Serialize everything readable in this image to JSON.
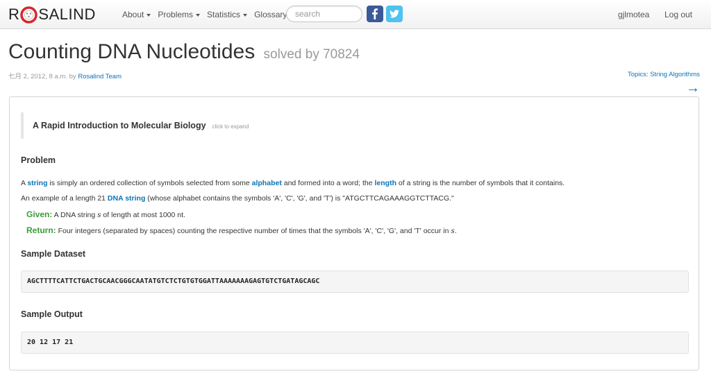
{
  "brand": {
    "name_left": "R",
    "name_right": "SALIND"
  },
  "nav": {
    "about": "About",
    "problems": "Problems",
    "statistics": "Statistics",
    "glossary": "Glossary",
    "search_placeholder": "search",
    "user": "gjlmotea",
    "logout": "Log out"
  },
  "header": {
    "title": "Counting DNA Nucleotides",
    "solved": "solved by 70824",
    "date": "七月 2, 2012, 8 a.m. by",
    "author": "Rosalind Team",
    "topics_label": "Topics",
    "topics_value": "String Algorithms",
    "next_arrow": "→"
  },
  "content": {
    "intro_title": "A Rapid Introduction to Molecular Biology",
    "intro_hint": "click to expand",
    "problem_heading": "Problem",
    "p1": {
      "a": "A ",
      "term1": "string",
      "b": " is simply an ordered collection of symbols selected from some ",
      "term2": "alphabet",
      "c": " and formed into a word; the ",
      "term3": "length",
      "d": " of a string is the number of symbols that it contains."
    },
    "p2": {
      "a": "An example of a length 21 ",
      "term": "DNA string",
      "b": " (whose alphabet contains the symbols 'A', 'C', 'G', and 'T') is \"ATGCTTCAGAAAGGTCTTACG.\""
    },
    "given": {
      "label": "Given:",
      "a": " A DNA string ",
      "var": "s",
      "b": " of length at most 1000 nt."
    },
    "return": {
      "label": "Return:",
      "a": " Four integers (separated by spaces) counting the respective number of times that the symbols 'A', 'C', 'G', and 'T' occur in ",
      "var": "s",
      "b": "."
    },
    "dataset_heading": "Sample Dataset",
    "dataset": "AGCTTTTCATTCTGACTGCAACGGGCAATATGTCTCTGTGTGGATTAAAAAAAGAGTGTCTGATAGCAGC",
    "output_heading": "Sample Output",
    "output": "20 12 17 21"
  },
  "colors": {
    "link": "#0b74b5",
    "green": "#3b9b3b",
    "logo_red": "#d9262b",
    "facebook": "#3b5998",
    "twitter": "#4ec2f1"
  },
  "icons": [
    "rosalind-logo-icon",
    "caret-down-icon",
    "facebook-icon",
    "twitter-icon",
    "arrow-right-icon"
  ]
}
